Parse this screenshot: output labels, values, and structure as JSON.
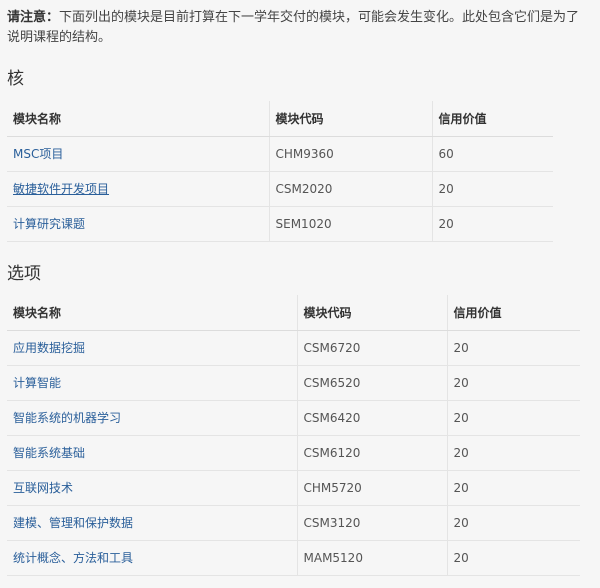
{
  "note": {
    "prefix": "请注意：",
    "text": "下面列出的模块是目前打算在下一学年交付的模块，可能会发生变化。此处包含它们是为了说明课程的结构。"
  },
  "core": {
    "heading": "核",
    "headers": [
      "模块名称",
      "模块代码",
      "信用价值"
    ],
    "rows": [
      {
        "name": "MSC项目",
        "code": "CHM9360",
        "credits": "60"
      },
      {
        "name": "敏捷软件开发项目",
        "code": "CSM2020",
        "credits": "20"
      },
      {
        "name": "计算研究课题",
        "code": "SEM1020",
        "credits": "20"
      }
    ]
  },
  "options": {
    "heading": "选项",
    "headers": [
      "模块名称",
      "模块代码",
      "信用价值"
    ],
    "rows": [
      {
        "name": "应用数据挖掘",
        "code": "CSM6720",
        "credits": "20"
      },
      {
        "name": "计算智能",
        "code": "CSM6520",
        "credits": "20"
      },
      {
        "name": "智能系统的机器学习",
        "code": "CSM6420",
        "credits": "20"
      },
      {
        "name": "智能系统基础",
        "code": "CSM6120",
        "credits": "20"
      },
      {
        "name": "互联网技术",
        "code": "CHM5720",
        "credits": "20"
      },
      {
        "name": "建模、管理和保护数据",
        "code": "CSM3120",
        "credits": "20"
      },
      {
        "name": "统计概念、方法和工具",
        "code": "MAM5120",
        "credits": "20"
      }
    ]
  }
}
